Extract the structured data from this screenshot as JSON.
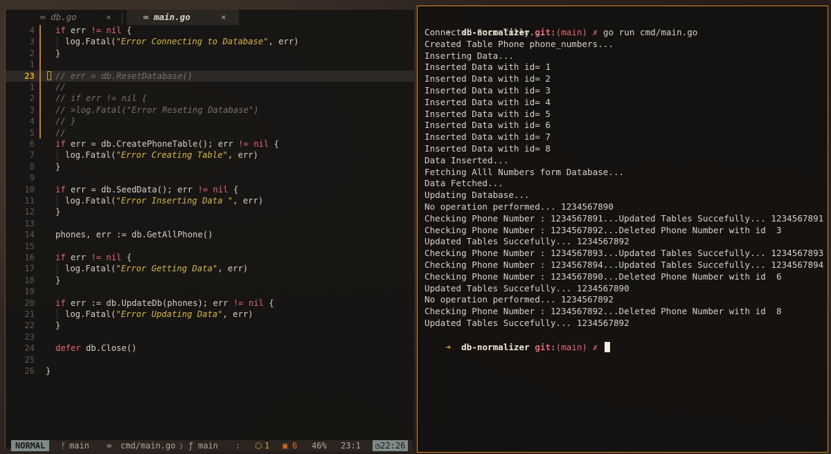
{
  "editor": {
    "tabs": [
      {
        "icon": "∞",
        "name": "db.go",
        "close": "×"
      },
      {
        "icon": "∞",
        "name": "main.go",
        "close": "×"
      }
    ],
    "lines": [
      {
        "n": "4",
        "git": true,
        "indent": 1,
        "parts": [
          [
            "kw",
            "if"
          ],
          [
            "fn",
            " err "
          ],
          [
            "kw",
            "!="
          ],
          [
            "fn",
            " "
          ],
          [
            "kw",
            "nil"
          ],
          [
            "fn",
            " {"
          ]
        ]
      },
      {
        "n": "3",
        "git": true,
        "indent": 2,
        "parts": [
          [
            "fn",
            "log.Fatal("
          ],
          [
            "str",
            "\"Error Connecting to Database\""
          ],
          [
            "fn",
            ", err)"
          ]
        ]
      },
      {
        "n": "2",
        "git": true,
        "indent": 1,
        "parts": [
          [
            "fn",
            "}"
          ]
        ]
      },
      {
        "n": "1",
        "git": true,
        "indent": 0,
        "parts": []
      },
      {
        "n": "23",
        "git": true,
        "indent": 1,
        "cur": true,
        "parts": [
          [
            "cmt",
            "// err = db.ResetDatabase()"
          ]
        ]
      },
      {
        "n": "1",
        "git": true,
        "indent": 1,
        "parts": [
          [
            "cmt",
            "//"
          ]
        ]
      },
      {
        "n": "2",
        "git": true,
        "indent": 1,
        "parts": [
          [
            "cmt",
            "// if err != nil {"
          ]
        ]
      },
      {
        "n": "3",
        "git": true,
        "indent": 1,
        "parts": [
          [
            "cmt",
            "// >log.Fatal(\"Error Reseting Database\")"
          ]
        ]
      },
      {
        "n": "4",
        "git": true,
        "indent": 1,
        "parts": [
          [
            "cmt",
            "// }"
          ]
        ]
      },
      {
        "n": "5",
        "git": true,
        "indent": 1,
        "parts": [
          [
            "cmt",
            "//"
          ]
        ]
      },
      {
        "n": "6",
        "git": false,
        "indent": 1,
        "parts": [
          [
            "kw",
            "if"
          ],
          [
            "fn",
            " err = db.CreatePhoneTable(); err "
          ],
          [
            "kw",
            "!="
          ],
          [
            "fn",
            " "
          ],
          [
            "kw",
            "nil"
          ],
          [
            "fn",
            " {"
          ]
        ]
      },
      {
        "n": "7",
        "git": false,
        "indent": 2,
        "parts": [
          [
            "fn",
            "log.Fatal("
          ],
          [
            "str",
            "\"Error Creating Table\""
          ],
          [
            "fn",
            ", err)"
          ]
        ]
      },
      {
        "n": "8",
        "git": false,
        "indent": 1,
        "parts": [
          [
            "fn",
            "}"
          ]
        ]
      },
      {
        "n": "9",
        "git": false,
        "indent": 0,
        "parts": []
      },
      {
        "n": "10",
        "git": false,
        "indent": 1,
        "parts": [
          [
            "kw",
            "if"
          ],
          [
            "fn",
            " err = db.SeedData(); err "
          ],
          [
            "kw",
            "!="
          ],
          [
            "fn",
            " "
          ],
          [
            "kw",
            "nil"
          ],
          [
            "fn",
            " {"
          ]
        ]
      },
      {
        "n": "11",
        "git": false,
        "indent": 2,
        "parts": [
          [
            "fn",
            "log.Fatal("
          ],
          [
            "str",
            "\"Error Inserting Data \""
          ],
          [
            "fn",
            ", err)"
          ]
        ]
      },
      {
        "n": "12",
        "git": false,
        "indent": 1,
        "parts": [
          [
            "fn",
            "}"
          ]
        ]
      },
      {
        "n": "13",
        "git": false,
        "indent": 0,
        "parts": []
      },
      {
        "n": "14",
        "git": false,
        "indent": 1,
        "parts": [
          [
            "fn",
            "phones, err := db.GetAllPhone()"
          ]
        ]
      },
      {
        "n": "15",
        "git": false,
        "indent": 0,
        "parts": []
      },
      {
        "n": "16",
        "git": false,
        "indent": 1,
        "parts": [
          [
            "kw",
            "if"
          ],
          [
            "fn",
            " err "
          ],
          [
            "kw",
            "!="
          ],
          [
            "fn",
            " "
          ],
          [
            "kw",
            "nil"
          ],
          [
            "fn",
            " {"
          ]
        ]
      },
      {
        "n": "17",
        "git": false,
        "indent": 2,
        "parts": [
          [
            "fn",
            "log.Fatal("
          ],
          [
            "str",
            "\"Error Getting Data\""
          ],
          [
            "fn",
            ", err)"
          ]
        ]
      },
      {
        "n": "18",
        "git": false,
        "indent": 1,
        "parts": [
          [
            "fn",
            "}"
          ]
        ]
      },
      {
        "n": "19",
        "git": false,
        "indent": 0,
        "parts": []
      },
      {
        "n": "20",
        "git": false,
        "indent": 1,
        "parts": [
          [
            "kw",
            "if"
          ],
          [
            "fn",
            " err := db.UpdateDb(phones); err "
          ],
          [
            "kw",
            "!="
          ],
          [
            "fn",
            " "
          ],
          [
            "kw",
            "nil"
          ],
          [
            "fn",
            " {"
          ]
        ]
      },
      {
        "n": "21",
        "git": false,
        "indent": 2,
        "parts": [
          [
            "fn",
            "log.Fatal("
          ],
          [
            "str",
            "\"Error Updating Data\""
          ],
          [
            "fn",
            ", err)"
          ]
        ]
      },
      {
        "n": "22",
        "git": false,
        "indent": 1,
        "parts": [
          [
            "fn",
            "}"
          ]
        ]
      },
      {
        "n": "23",
        "git": false,
        "indent": 0,
        "parts": []
      },
      {
        "n": "24",
        "git": false,
        "indent": 1,
        "parts": [
          [
            "kw",
            "defer"
          ],
          [
            "fn",
            " db.Close()"
          ]
        ]
      },
      {
        "n": "25",
        "git": false,
        "indent": 0,
        "parts": []
      },
      {
        "n": "26",
        "git": false,
        "indent": 0,
        "parts": [
          [
            "fn",
            "}"
          ]
        ]
      }
    ]
  },
  "statusline": {
    "mode": "NORMAL",
    "branch_icon": "ᚠ",
    "branch": "main",
    "file_icon": "∞",
    "file": "cmd/main.go",
    "func_icon": "ƒ",
    "func": "main",
    "colon": ":",
    "warn_icon": "⬡",
    "warn_count": "1",
    "err_icon": "▣",
    "err_count": "6",
    "percent": "46%",
    "position": "23:1",
    "time_icon": "◷",
    "time": "22:26"
  },
  "terminal": {
    "prompt": {
      "arrow": "➜",
      "repo": "db-normalizer",
      "git_label": "git:",
      "branch": "(main)",
      "dirty": "✗"
    },
    "command": "go run cmd/main.go",
    "output": [
      "Connected Succefully...",
      "Created Table Phone phone_numbers...",
      "Inserting Data...",
      "Inserted Data with id= 1",
      "Inserted Data with id= 2",
      "Inserted Data with id= 3",
      "Inserted Data with id= 4",
      "Inserted Data with id= 5",
      "Inserted Data with id= 6",
      "Inserted Data with id= 7",
      "Inserted Data with id= 8",
      "Data Inserted...",
      "Fetching Alll Numbers form Database...",
      "Data Fetched...",
      "Updating Database...",
      "No operation performed... 1234567890",
      "Checking Phone Number : 1234567891...Updated Tables Succefully... 1234567891",
      "Checking Phone Number : 1234567892...Deleted Phone Number with id  3",
      "Updated Tables Succefully... 1234567892",
      "Checking Phone Number : 1234567893...Updated Tables Succefully... 1234567893",
      "Checking Phone Number : 1234567894...Updated Tables Succefully... 1234567894",
      "Checking Phone Number : 1234567890...Deleted Phone Number with id  6",
      "Updated Tables Succefully... 1234567890",
      "No operation performed... 1234567892",
      "Checking Phone Number : 1234567892...Deleted Phone Number with id  8",
      "Updated Tables Succefully... 1234567892"
    ]
  }
}
